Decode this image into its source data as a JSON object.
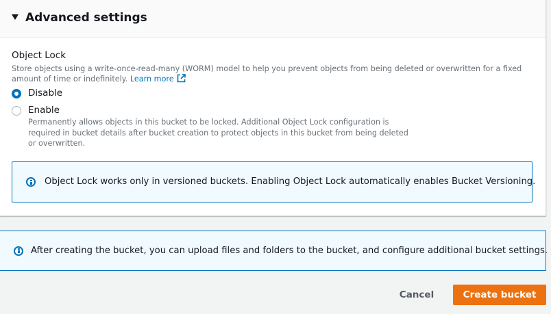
{
  "advanced_settings": {
    "title": "Advanced settings",
    "object_lock": {
      "label": "Object Lock",
      "description": "Store objects using a write-once-read-many (WORM) model to help you prevent objects from being deleted or overwritten for a fixed amount of time or indefinitely.",
      "learn_more": "Learn more",
      "options": [
        {
          "label": "Disable",
          "checked": true
        },
        {
          "label": "Enable",
          "checked": false,
          "description": "Permanently allows objects in this bucket to be locked. Additional Object Lock configuration is required in bucket details after bucket creation to protect objects in this bucket from being deleted or overwritten."
        }
      ],
      "alert": "Object Lock works only in versioned buckets. Enabling Object Lock automatically enables Bucket Versioning."
    }
  },
  "info_alert": "After creating the bucket, you can upload files and folders to the bucket, and configure additional bucket settings.",
  "footer": {
    "cancel_label": "Cancel",
    "create_label": "Create bucket"
  },
  "colors": {
    "primary": "#ec7211",
    "link": "#0073bb",
    "alert_bg": "#f1faff"
  },
  "icons": {
    "caret": "caret-down-icon",
    "external": "external-link-icon",
    "info": "info-icon"
  }
}
